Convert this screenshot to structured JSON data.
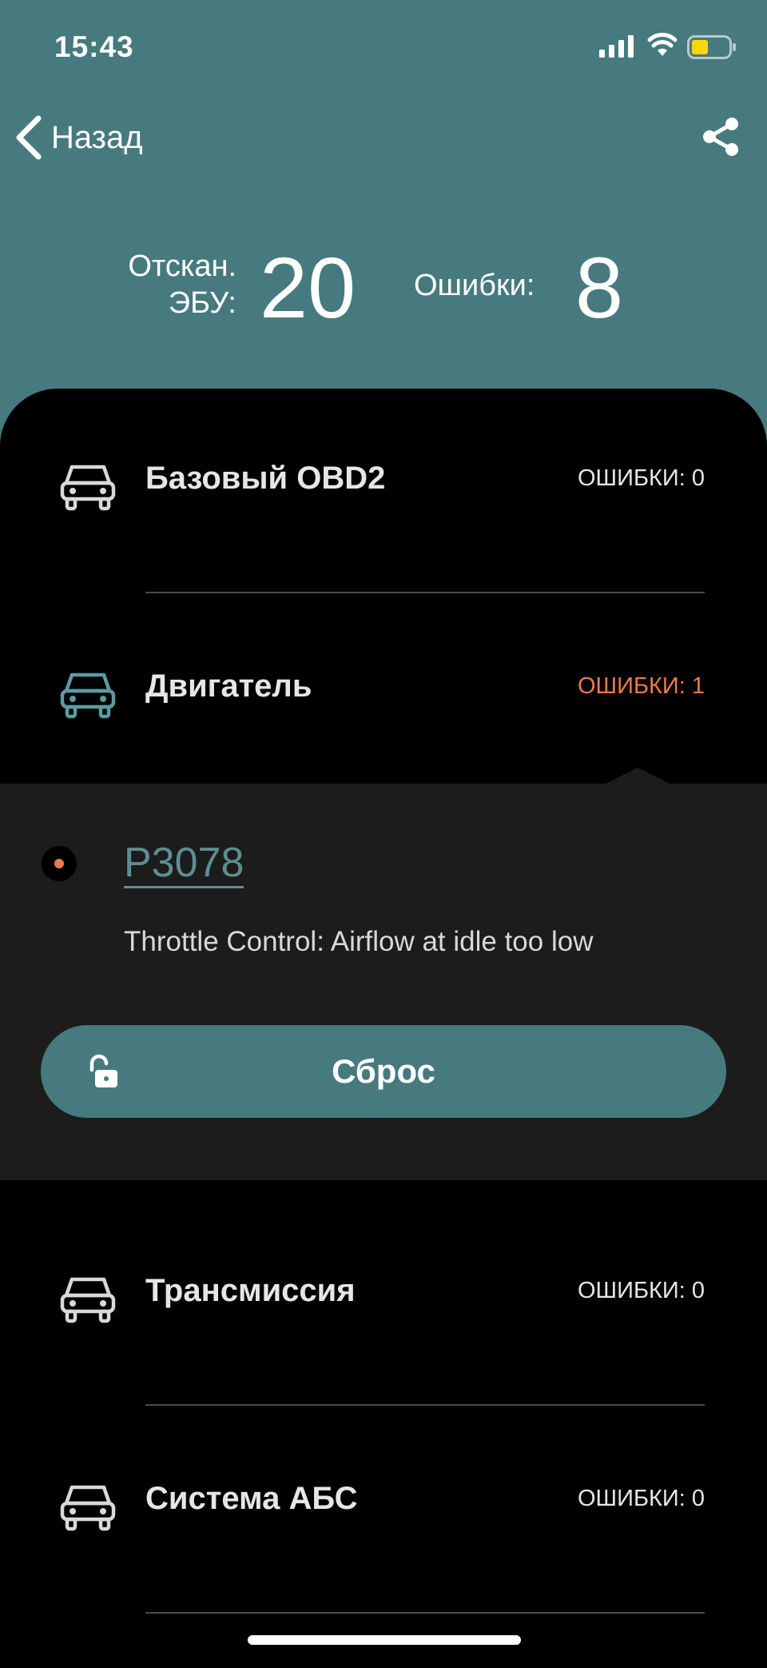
{
  "status": {
    "time": "15:43"
  },
  "nav": {
    "back_label": "Назад"
  },
  "summary": {
    "scanned_label_line1": "Отскан.",
    "scanned_label_line2": "ЭБУ:",
    "scanned_value": "20",
    "errors_label": "Ошибки:",
    "errors_value": "8"
  },
  "ecus": [
    {
      "name": "Базовый OBD2",
      "errors": "ОШИБКИ: 0",
      "has_errors": false
    },
    {
      "name": "Двигатель",
      "errors": "ОШИБКИ: 1",
      "has_errors": true
    },
    {
      "name": "Трансмиссия",
      "errors": "ОШИБКИ: 0",
      "has_errors": false
    },
    {
      "name": "Система АБС",
      "errors": "ОШИБКИ: 0",
      "has_errors": false
    }
  ],
  "fault": {
    "code": "P3078",
    "description": "Throttle Control: Airflow at idle too low",
    "reset_label": "Сброс"
  },
  "colors": {
    "accent": "#467a7e",
    "error": "#ec7a4e",
    "code_link": "#5d8e91",
    "background": "#000000",
    "panel": "#1c1c1c"
  },
  "icons": [
    "signal-icon",
    "wifi-icon",
    "battery-icon",
    "chevron-left-icon",
    "share-icon",
    "car-icon",
    "unlock-icon"
  ]
}
